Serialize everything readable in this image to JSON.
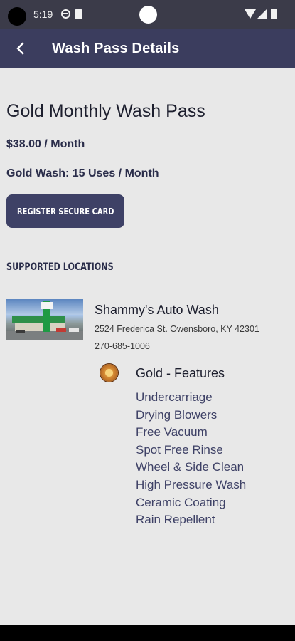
{
  "status_bar": {
    "time": "5:19"
  },
  "app_bar": {
    "back_icon": "chevron-left-icon",
    "title": "Wash Pass Details"
  },
  "pass": {
    "title": "Gold Monthly Wash Pass",
    "price": "$38.00 / Month",
    "uses": "Gold Wash: 15 Uses / Month",
    "register_button_label": "REGISTER SECURE CARD"
  },
  "supported_locations": {
    "heading": "SUPPORTED LOCATIONS",
    "locations": [
      {
        "name": "Shammy's Auto Wash",
        "address": "2524 Frederica St. Owensboro, KY 42301",
        "phone": "270-685-1006",
        "tier_icon": "gold-medal-icon",
        "features_heading": "Gold - Features",
        "features": [
          "Undercarriage",
          "Drying Blowers",
          "Free Vacuum",
          "Spot Free Rinse",
          "Wheel & Side Clean",
          "High Pressure Wash",
          "Ceramic Coating",
          "Rain Repellent"
        ]
      }
    ]
  },
  "colors": {
    "app_bar": "#3b3d5e",
    "button": "#3e4166",
    "background": "#e8e8e8",
    "text_dark": "#1d1f2e",
    "text_navy": "#2a2d4a"
  }
}
